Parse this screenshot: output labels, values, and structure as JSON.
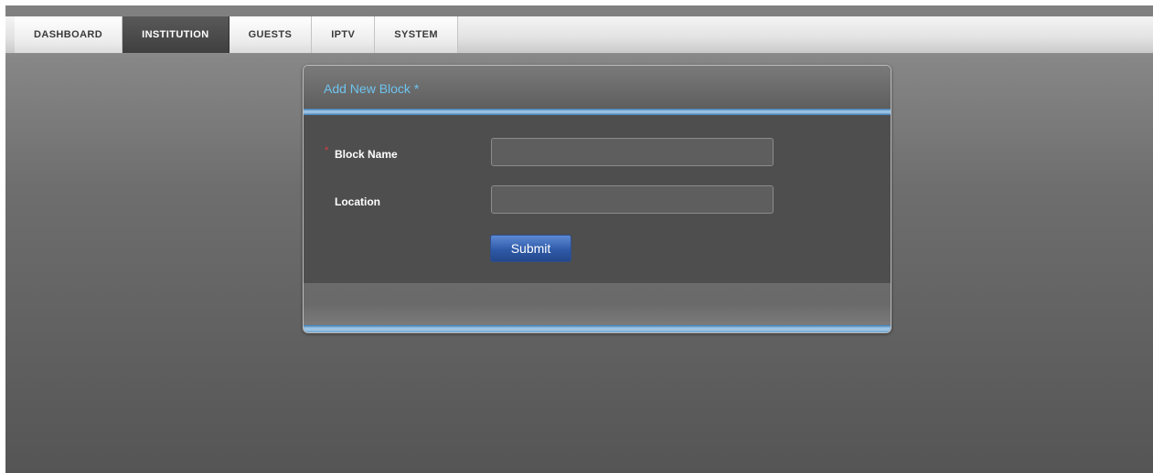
{
  "nav": {
    "tabs": [
      {
        "label": "DASHBOARD"
      },
      {
        "label": "INSTITUTION"
      },
      {
        "label": "GUESTS"
      },
      {
        "label": "IPTV"
      },
      {
        "label": "SYSTEM"
      }
    ],
    "active_tab": "INSTITUTION"
  },
  "form": {
    "title": "Add New Block *",
    "fields": [
      {
        "label": "Block Name",
        "required": true,
        "value": "",
        "placeholder": ""
      },
      {
        "label": "Location",
        "required": false,
        "value": "",
        "placeholder": ""
      }
    ],
    "required_marker": "*",
    "submit_label": "Submit"
  },
  "colors": {
    "title_color": "#6ec3ee",
    "accent_rule": "#9dc4e3",
    "submit_button": "#2f5aa8",
    "required_star": "#e23b3b",
    "active_tab_bg": "#4a4a4a"
  }
}
